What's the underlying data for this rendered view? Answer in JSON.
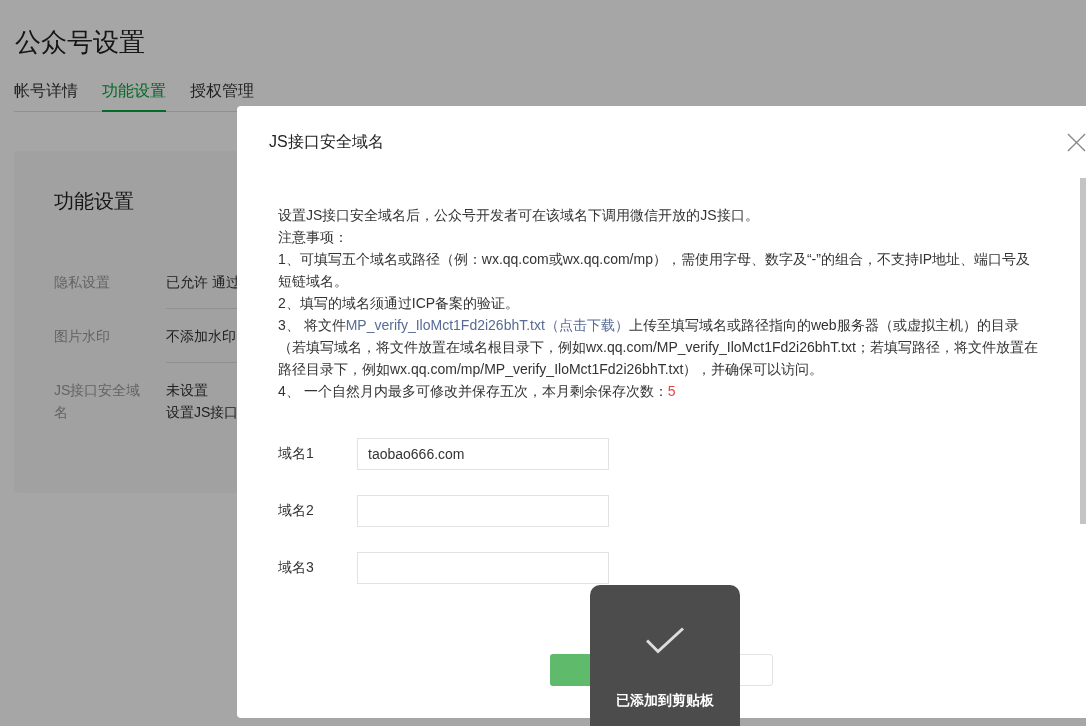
{
  "page": {
    "title": "公众号设置",
    "tabs": [
      {
        "label": "帐号详情",
        "selected": false
      },
      {
        "label": "功能设置",
        "selected": true
      },
      {
        "label": "授权管理",
        "selected": false
      }
    ],
    "card": {
      "title": "功能设置",
      "rows": [
        {
          "label": "隐私设置",
          "values": [
            "已允许 通过"
          ]
        },
        {
          "label": "图片水印",
          "values": [
            "不添加水印"
          ]
        },
        {
          "label": "JS接口安全域名",
          "values": [
            "未设置",
            "设置JS接口"
          ]
        }
      ]
    }
  },
  "dialog": {
    "title": "JS接口安全域名",
    "notes": [
      {
        "kind": "plain",
        "text": "设置JS接口安全域名后，公众号开发者可在该域名下调用微信开放的JS接口。"
      },
      {
        "kind": "plain",
        "text": "注意事项："
      },
      {
        "kind": "plain",
        "text": "1、可填写五个域名或路径（例：wx.qq.com或wx.qq.com/mp），需使用字母、数字及“-”的组合，不支持IP地址、端口号及短链域名。"
      },
      {
        "kind": "plain",
        "text": "2、填写的域名须通过ICP备案的验证。"
      },
      {
        "kind": "link",
        "before": "3、 将文件",
        "link": "MP_verify_IloMct1Fd2i26bhT.txt（点击下载）",
        "after": "上传至填写域名或路径指向的web服务器（或虚拟主机）的目录（若填写域名，将文件放置在域名根目录下，例如wx.qq.com/MP_verify_IloMct1Fd2i26bhT.txt；若填写路径，将文件放置在路径目录下，例如wx.qq.com/mp/MP_verify_IloMct1Fd2i26bhT.txt），并确保可以访问。"
      },
      {
        "kind": "count",
        "text": "4、 一个自然月内最多可修改并保存五次，本月剩余保存次数：",
        "count": "5"
      }
    ],
    "domains": [
      {
        "label": "域名1",
        "value": "taobao666.com"
      },
      {
        "label": "域名2"
      },
      {
        "label": "域名3"
      }
    ],
    "buttons": [
      {
        "kind": "primary"
      },
      {
        "kind": "secondary"
      }
    ]
  },
  "toast": {
    "message": "已添加到剪贴板"
  }
}
